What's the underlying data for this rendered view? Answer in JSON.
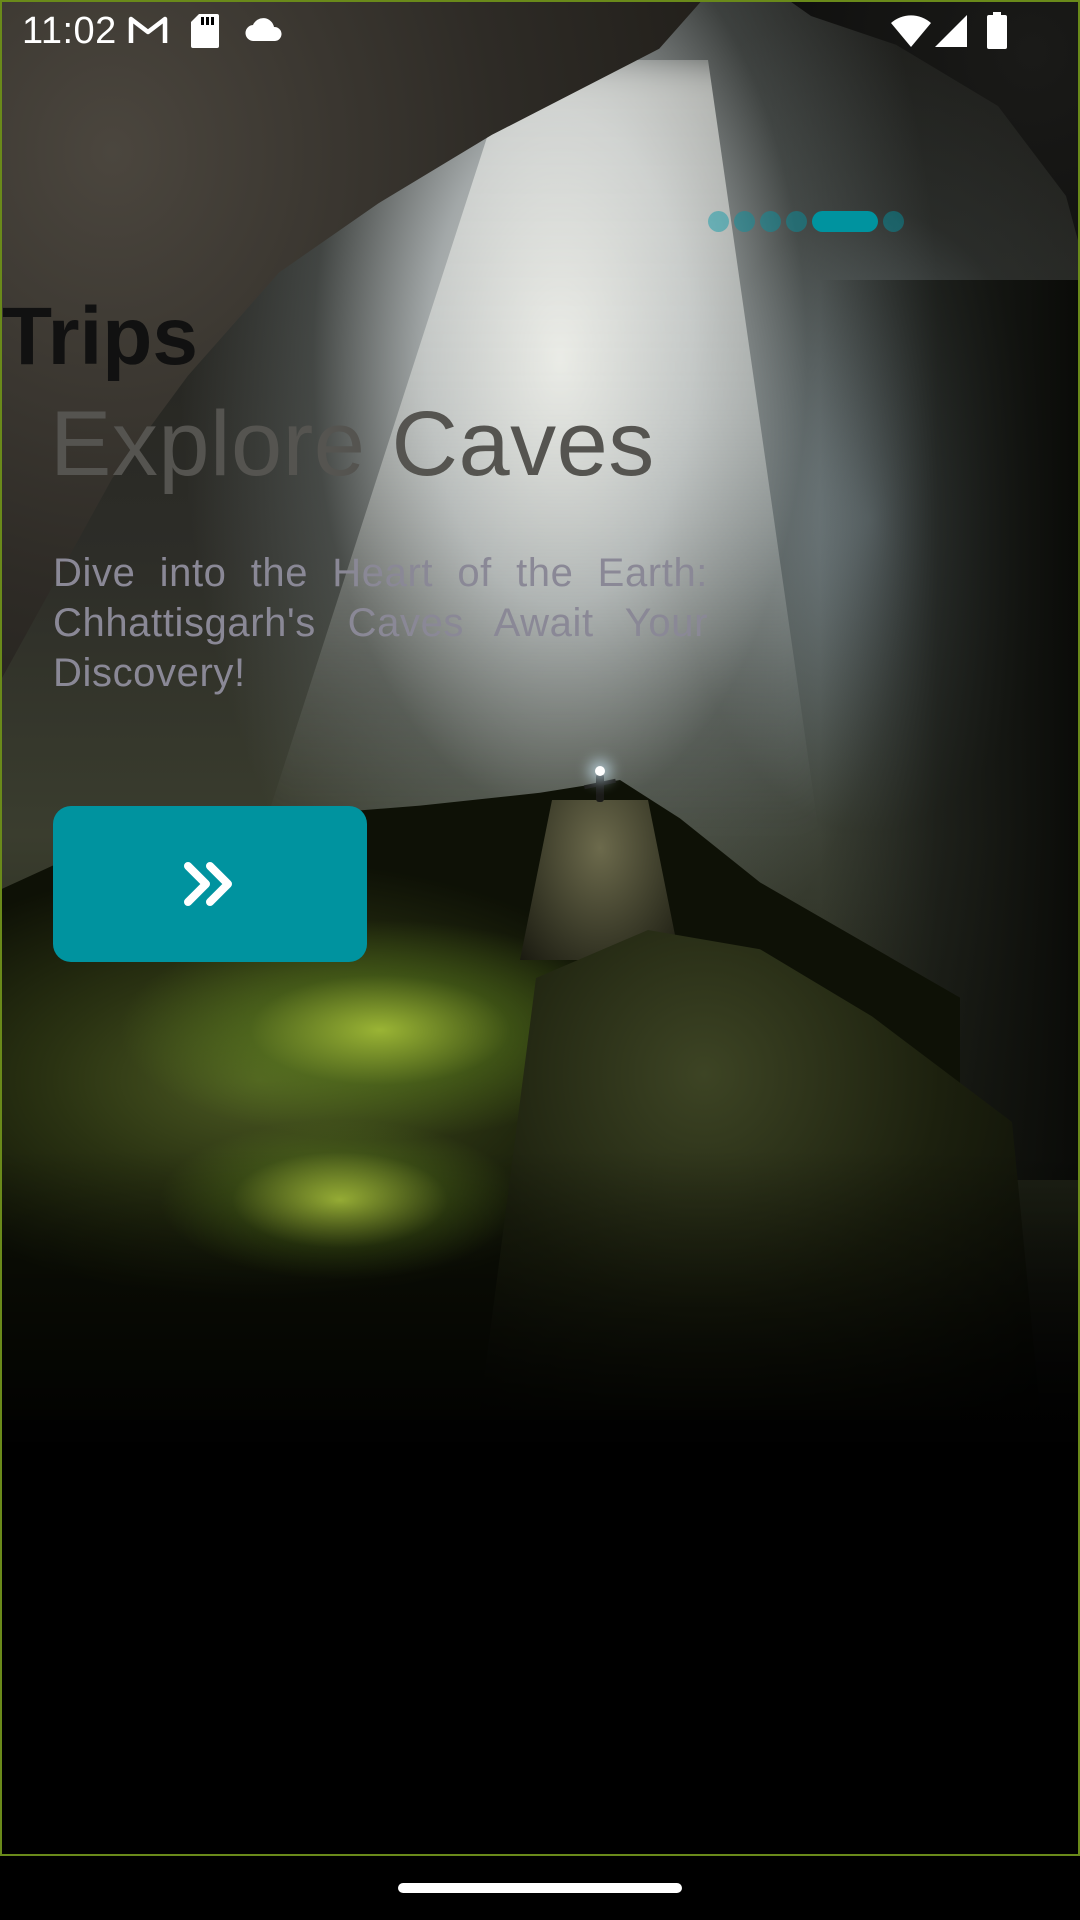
{
  "status_bar": {
    "time": "11:02",
    "icons": [
      "gmail-icon",
      "sd-card-icon",
      "cloud-icon",
      "wifi-icon",
      "signal-icon",
      "battery-icon"
    ]
  },
  "onboarding": {
    "category": "Trips",
    "title": "Explore Caves",
    "description": "Dive into the Heart of the Earth: Chhattisgarh's Caves Await Your Discovery!",
    "page_indicator": {
      "total": 6,
      "active_index": 4
    },
    "next_button": {
      "icon": "double-chevron-right-icon"
    }
  },
  "colors": {
    "accent": "#00939f",
    "title_text": "#555450",
    "description_text": "#8a8896",
    "frame_border": "#6a8a1a"
  }
}
